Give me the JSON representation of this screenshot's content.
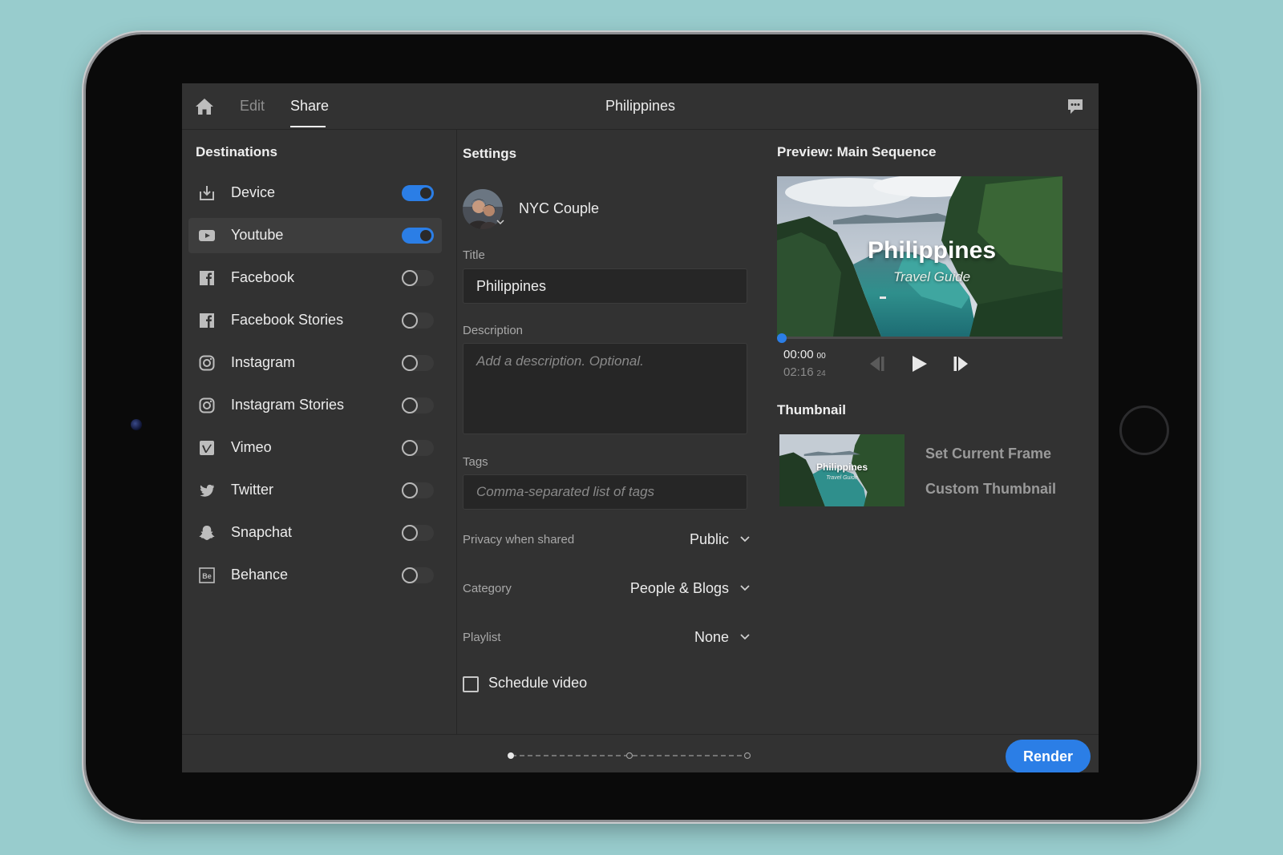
{
  "topbar": {
    "tabs": [
      {
        "label": "Edit",
        "active": false
      },
      {
        "label": "Share",
        "active": true
      }
    ],
    "title": "Philippines"
  },
  "destinations": {
    "heading": "Destinations",
    "items": [
      {
        "label": "Device",
        "icon": "download-icon",
        "enabled": true
      },
      {
        "label": "Youtube",
        "icon": "youtube-icon",
        "enabled": true,
        "selected": true
      },
      {
        "label": "Facebook",
        "icon": "facebook-icon",
        "enabled": false
      },
      {
        "label": "Facebook Stories",
        "icon": "facebook-icon",
        "enabled": false
      },
      {
        "label": "Instagram",
        "icon": "instagram-icon",
        "enabled": false
      },
      {
        "label": "Instagram Stories",
        "icon": "instagram-icon",
        "enabled": false
      },
      {
        "label": "Vimeo",
        "icon": "vimeo-icon",
        "enabled": false
      },
      {
        "label": "Twitter",
        "icon": "twitter-icon",
        "enabled": false
      },
      {
        "label": "Snapchat",
        "icon": "snapchat-icon",
        "enabled": false
      },
      {
        "label": "Behance",
        "icon": "behance-icon",
        "enabled": false
      }
    ]
  },
  "settings": {
    "heading": "Settings",
    "account_name": "NYC Couple",
    "title_label": "Title",
    "title_value": "Philippines",
    "description_label": "Description",
    "description_placeholder": "Add a description. Optional.",
    "tags_label": "Tags",
    "tags_placeholder": "Comma-separated list of tags",
    "privacy_label": "Privacy when shared",
    "privacy_value": "Public",
    "category_label": "Category",
    "category_value": "People & Blogs",
    "playlist_label": "Playlist",
    "playlist_value": "None",
    "schedule_label": "Schedule video",
    "schedule_checked": false
  },
  "preview": {
    "heading": "Preview: Main Sequence",
    "video_title": "Philippines",
    "video_subtitle": "Travel Guide",
    "timecode_current": "00:00",
    "timecode_current_frames": "00",
    "timecode_total": "02:16",
    "timecode_total_frames": "24",
    "playhead_progress": 0.0
  },
  "thumbnail": {
    "heading": "Thumbnail",
    "title": "Philippines",
    "subtitle": "Travel Guide",
    "set_current_frame": "Set Current Frame",
    "custom_thumbnail": "Custom Thumbnail"
  },
  "footer": {
    "render_label": "Render",
    "current_step": 1,
    "total_steps": 3
  },
  "colors": {
    "accent": "#2b7ee6",
    "panel": "#323232",
    "field": "#262626",
    "background": "#98cccd"
  }
}
